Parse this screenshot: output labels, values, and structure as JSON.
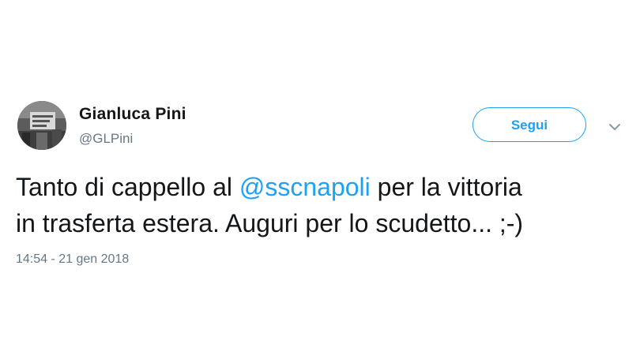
{
  "author": {
    "display_name": "Gianluca Pini",
    "handle": "@GLPini"
  },
  "actions": {
    "follow_label": "Segui",
    "more_icon": "chevron-down-icon"
  },
  "tweet": {
    "text_before": "Tanto di cappello al ",
    "mention": "@sscnapoli",
    "text_line1_after": " per la vittoria",
    "text_line2": "in trasferta estera. Auguri per lo scudetto...  ;-)",
    "timestamp": "14:54 - 21 gen 2018"
  },
  "colors": {
    "accent": "#1da1f2",
    "text": "#14171a",
    "muted": "#657786"
  }
}
